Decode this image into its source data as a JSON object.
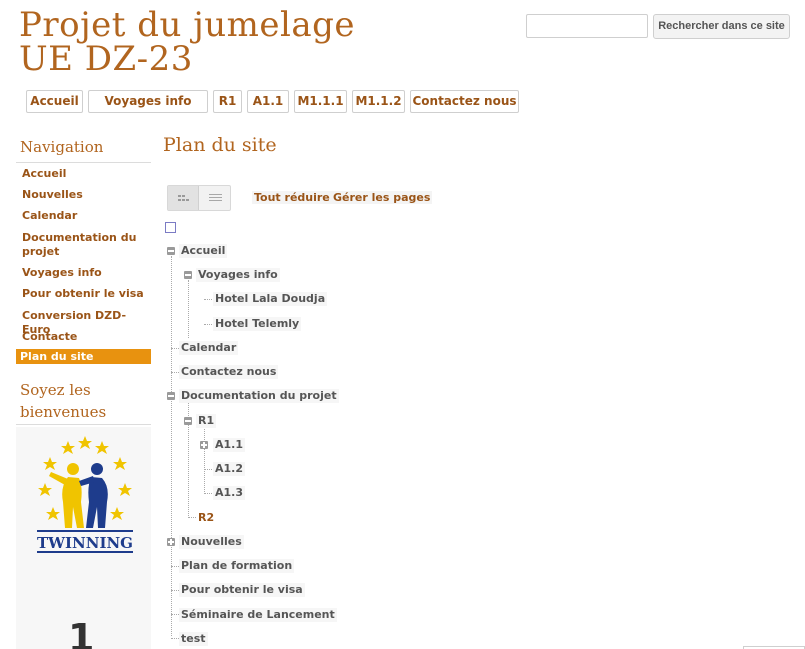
{
  "site": {
    "title_line1": "Projet du jumelage",
    "title_line2": "UE DZ-23"
  },
  "search": {
    "placeholder": "",
    "button_label": "Rechercher dans ce site"
  },
  "top_nav": [
    "Accueil",
    "Voyages info",
    "R1",
    "A1.1",
    "M1.1.1",
    "M1.1.2",
    "Contactez nous"
  ],
  "sidebar": {
    "title": "Navigation",
    "items": [
      "Accueil",
      "Nouvelles",
      "Calendar",
      "Documentation du projet",
      "Voyages info",
      "Pour obtenir le visa",
      "Conversion DZD- Euro",
      "Contacte",
      "Plan du site"
    ],
    "active_index": 8,
    "welcome_title": "Soyez les bienvenues",
    "logo_text": "TWINNING",
    "counter_digit": "1"
  },
  "main": {
    "page_title": "Plan du site",
    "collapse_all": "Tout réduire",
    "manage_pages": "Gérer les pages"
  },
  "tree": [
    {
      "label": "Accueil"
    },
    {
      "label": "Voyages info"
    },
    {
      "label": "Hotel Lala Doudja"
    },
    {
      "label": "Hotel Telemly"
    },
    {
      "label": "Calendar"
    },
    {
      "label": "Contactez nous"
    },
    {
      "label": "Documentation du projet"
    },
    {
      "label": "R1"
    },
    {
      "label": "A1.1"
    },
    {
      "label": "A1.2"
    },
    {
      "label": "A1.3"
    },
    {
      "label": "R2"
    },
    {
      "label": "Nouvelles"
    },
    {
      "label": "Plan de formation"
    },
    {
      "label": "Pour obtenir le visa"
    },
    {
      "label": "Séminaire de Lancement"
    },
    {
      "label": "test"
    }
  ],
  "colors": {
    "brand": "#b1651f",
    "link": "#9a5417",
    "active": "#e8920f"
  }
}
